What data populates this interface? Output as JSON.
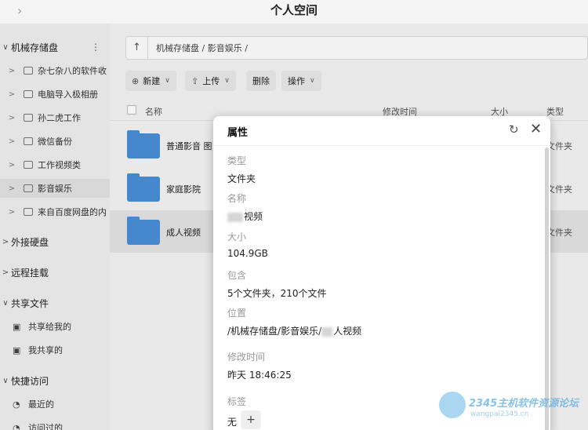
{
  "window": {
    "title": "个人空间"
  },
  "sidebar": {
    "storage_label": "机械存储盘",
    "folders": [
      {
        "label": "杂七杂八的软件收"
      },
      {
        "label": "电脑导入极相册"
      },
      {
        "label": "孙二虎工作"
      },
      {
        "label": "微信备份"
      },
      {
        "label": "工作视频类"
      },
      {
        "label": "影音娱乐"
      },
      {
        "label": "来自百度网盘的内"
      }
    ],
    "external_label": "外接硬盘",
    "remote_label": "远程挂载",
    "shared_label": "共享文件",
    "shared_items": [
      {
        "label": "共享给我的"
      },
      {
        "label": "我共享的"
      }
    ],
    "quick_label": "快捷访问",
    "quick_items": [
      {
        "label": "最近的"
      },
      {
        "label": "访问过的"
      }
    ]
  },
  "pathbar": {
    "path": "机械存储盘 / 影音娱乐 /"
  },
  "toolbar": {
    "new_label": "新建",
    "upload_label": "上传",
    "delete_label": "删除",
    "action_label": "操作"
  },
  "table": {
    "headers": {
      "name": "名称",
      "modified": "修改时间",
      "size": "大小",
      "type": "类型"
    },
    "rows": [
      {
        "name": "普通影音 图",
        "type": "文件夹"
      },
      {
        "name": "家庭影院",
        "type": "文件夹"
      },
      {
        "name": "成人视频",
        "type": "文件夹"
      }
    ]
  },
  "dialog": {
    "title": "属性",
    "type_label": "类型",
    "type_value": "文件夹",
    "name_label": "名称",
    "name_value": "视频",
    "size_label": "大小",
    "size_value": "104.9GB",
    "contains_label": "包含",
    "contains_value": "5个文件夹，210个文件",
    "location_label": "位置",
    "location_prefix": "/机械存储盘/影音娱乐/",
    "location_suffix": "人视频",
    "modified_label": "修改时间",
    "modified_value": "昨天 18:46:25",
    "tags_label": "标签",
    "tags_value": "无"
  },
  "watermark": {
    "brand": "2345主机软件资源论坛",
    "url": "wangpai2345.cn"
  },
  "colors": {
    "folder": "#4a90d9",
    "selected_row": "#e5e5e5"
  }
}
